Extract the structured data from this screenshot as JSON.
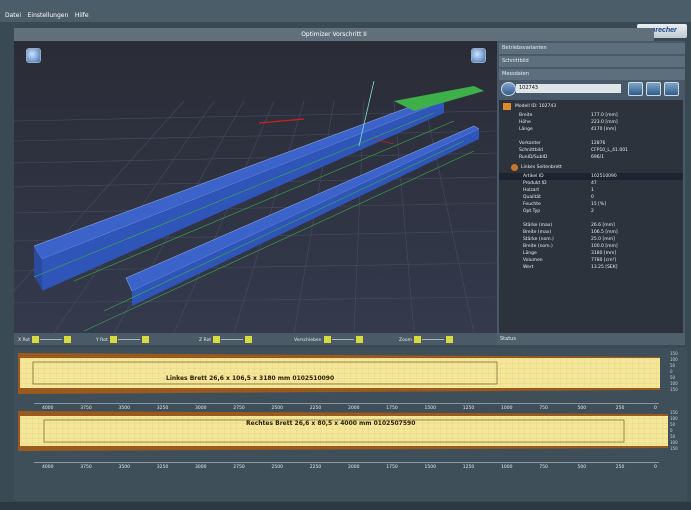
{
  "menu": {
    "items": [
      "Datei",
      "Einstellungen",
      "Hilfe"
    ]
  },
  "brand": {
    "logo_text": "sprecher"
  },
  "window": {
    "title": "Optimizer Vorschritt II"
  },
  "viewport3d": {
    "buttons": [
      "view-icon",
      "view-icon"
    ]
  },
  "right_panel": {
    "items": [
      "Betriebsvarianten",
      "Schnittbild",
      "Messdaten"
    ],
    "id_input_value": "102743",
    "tree": {
      "root": "Modell ID: 102743",
      "rows": [
        {
          "k": "Breite",
          "v": "177.0 [mm]"
        },
        {
          "k": "Höhe",
          "v": "223.0 [mm]"
        },
        {
          "k": "Länge",
          "v": "4170 [mm]"
        },
        {
          "k": "",
          "v": ""
        },
        {
          "k": "Vorkanter",
          "v": "12876"
        },
        {
          "k": "Schnittbild",
          "v": "CFP10_L_41.001"
        },
        {
          "k": "RunID/SubID",
          "v": "696/1"
        }
      ],
      "group": "Linkes Seitenbrett",
      "sub_rows": [
        {
          "k": "Artikel ID",
          "v": "102510090",
          "sel": true
        },
        {
          "k": "Produkt ID",
          "v": "47"
        },
        {
          "k": "Holzart",
          "v": "1"
        },
        {
          "k": "Qualität",
          "v": "0"
        },
        {
          "k": "Feuchte",
          "v": "15 [%]"
        },
        {
          "k": "Opt.Typ",
          "v": "2"
        },
        {
          "k": "",
          "v": ""
        },
        {
          "k": "Stärke (max)",
          "v": "26.6 [mm]"
        },
        {
          "k": "Breite (max)",
          "v": "106.5 [mm]"
        },
        {
          "k": "Stärke (nom.)",
          "v": "25.0 [mm]"
        },
        {
          "k": "Breite (nom.)",
          "v": "100.0 [mm]"
        },
        {
          "k": "Länge",
          "v": "3180 [mm]"
        },
        {
          "k": "Volumen",
          "v": "7780 [cm³]"
        },
        {
          "k": "Wert",
          "v": "13.25 [SEK]"
        }
      ]
    },
    "status_label": "Status"
  },
  "controls": [
    {
      "label": "X Rot"
    },
    {
      "label": "Y Rot"
    },
    {
      "label": "Z Rot"
    },
    {
      "label": "Verschieben"
    },
    {
      "label": "Zoom"
    }
  ],
  "boards": [
    {
      "label": "Linkes Brett  26,6 x 106,5 x 3180 mm  0102510090"
    },
    {
      "label": "Rechtes Brett  26,6 x 80,5 x 4000 mm  0102507590"
    }
  ],
  "axis_ticks": [
    "4000",
    "3750",
    "3500",
    "3250",
    "3000",
    "2750",
    "2500",
    "2250",
    "2000",
    "1750",
    "1500",
    "1250",
    "1000",
    "750",
    "500",
    "250",
    "0"
  ],
  "right_scale": [
    "150",
    "100",
    "50",
    "0",
    "50",
    "100",
    "150"
  ],
  "colors": {
    "board": "#f4e79a",
    "bark": "#9a5a1e",
    "shape3d": "#3b63c9"
  }
}
